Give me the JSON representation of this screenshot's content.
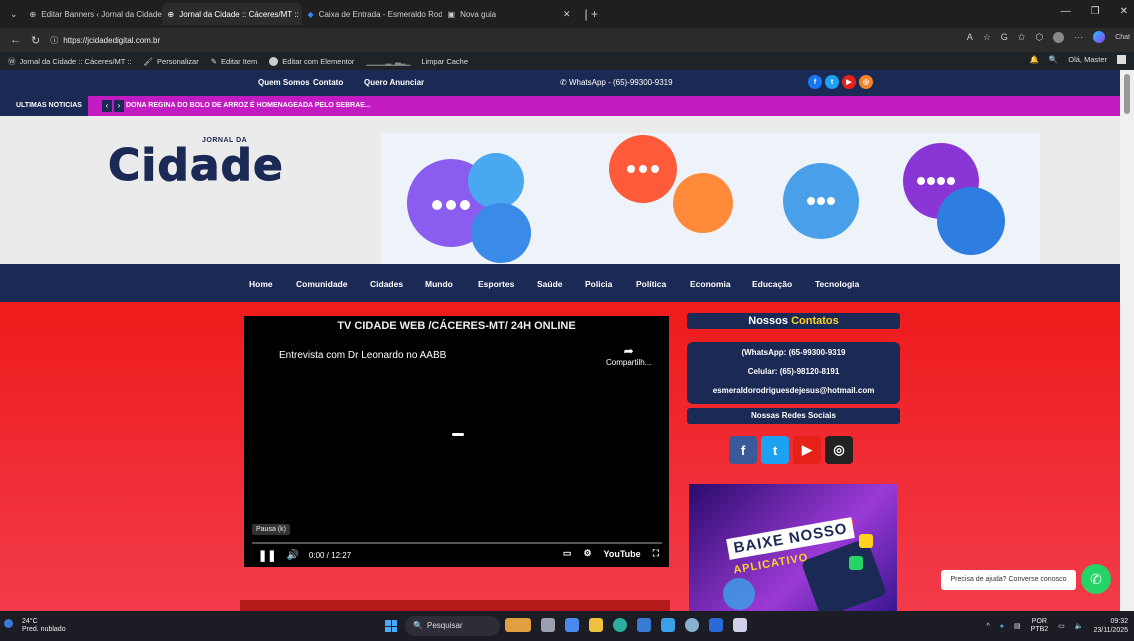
{
  "browser": {
    "tabs": [
      {
        "label": "Editar Banners ‹ Jornal da Cidade ::",
        "active": false
      },
      {
        "label": "Jornal da Cidade :: Cáceres/MT ::",
        "active": true
      },
      {
        "label": "Caixa de Entrada - Esmeraldo Rod",
        "active": false
      },
      {
        "label": "Nova guia",
        "active": false
      }
    ],
    "url": "https://jcidadedigital.com.br",
    "read_aloud_icon": "A",
    "chat_label": "Chat"
  },
  "wp_admin": {
    "site": "Jornal da Cidade :: Cáceres/MT ::",
    "customize": "Personalizar",
    "edit_item": "Editar Item",
    "elementor": "Editar com Elementor",
    "cache": "Limpar Cache",
    "greeting": "Olá, Master"
  },
  "topbar": {
    "links": [
      "Quem Somos",
      "Contato",
      "Quero Anunciar"
    ],
    "whatsapp": "WhatsApp - (65)-99300-9319",
    "social": [
      {
        "icon": "facebook-icon",
        "color": "#1877f2",
        "glyph": "f"
      },
      {
        "icon": "twitter-icon",
        "color": "#1da1f2",
        "glyph": "t"
      },
      {
        "icon": "youtube-icon",
        "color": "#e62117",
        "glyph": "▶"
      },
      {
        "icon": "instagram-icon",
        "color": "#f58529",
        "glyph": "◎"
      }
    ]
  },
  "ticker": {
    "label": "ULTIMAS NOTICIAS",
    "headline": "DONA REGINA DO BOLO DE ARROZ É HOMENAGEADA PELO SEBRAE..."
  },
  "logo": {
    "small": "JORNAL DA",
    "big": "Cidade"
  },
  "nav": [
    "Home",
    "Comunidade",
    "Cidades",
    "Mundo",
    "Esportes",
    "Saúde",
    "Policia",
    "Política",
    "Economia",
    "Educação",
    "Tecnologia"
  ],
  "video": {
    "title": "TV CIDADE WEB /CÁCERES-MT/ 24H ONLINE",
    "subtitle": "Entrevista com Dr Leonardo no AABB",
    "share": "Compartilh...",
    "pause_tip": "Pausa (k)",
    "time": "0:00 / 12:27",
    "youtube": "YouTube"
  },
  "sidebar": {
    "contacts_title_a": "Nossos ",
    "contacts_title_b": "Contatos",
    "whatsapp": "(WhatsApp: (65-99300-9319",
    "cell": "Celular: (65)-98120-8191",
    "email": "esmeraldorodriguesdejesus@hotmail.com",
    "social_title": "Nossas Redes Sociais",
    "app_line1": "BAIXE NOSSO",
    "app_line2": "APLICATIVO"
  },
  "help_bubble": "Precisa de ajuda? Converse conosco",
  "taskbar": {
    "temp": "24°C",
    "weather": "Pred. nublado",
    "search": "Pesquisar",
    "lang1": "POR",
    "lang2": "PTB2",
    "time": "09:32",
    "date": "23/11/2025"
  }
}
